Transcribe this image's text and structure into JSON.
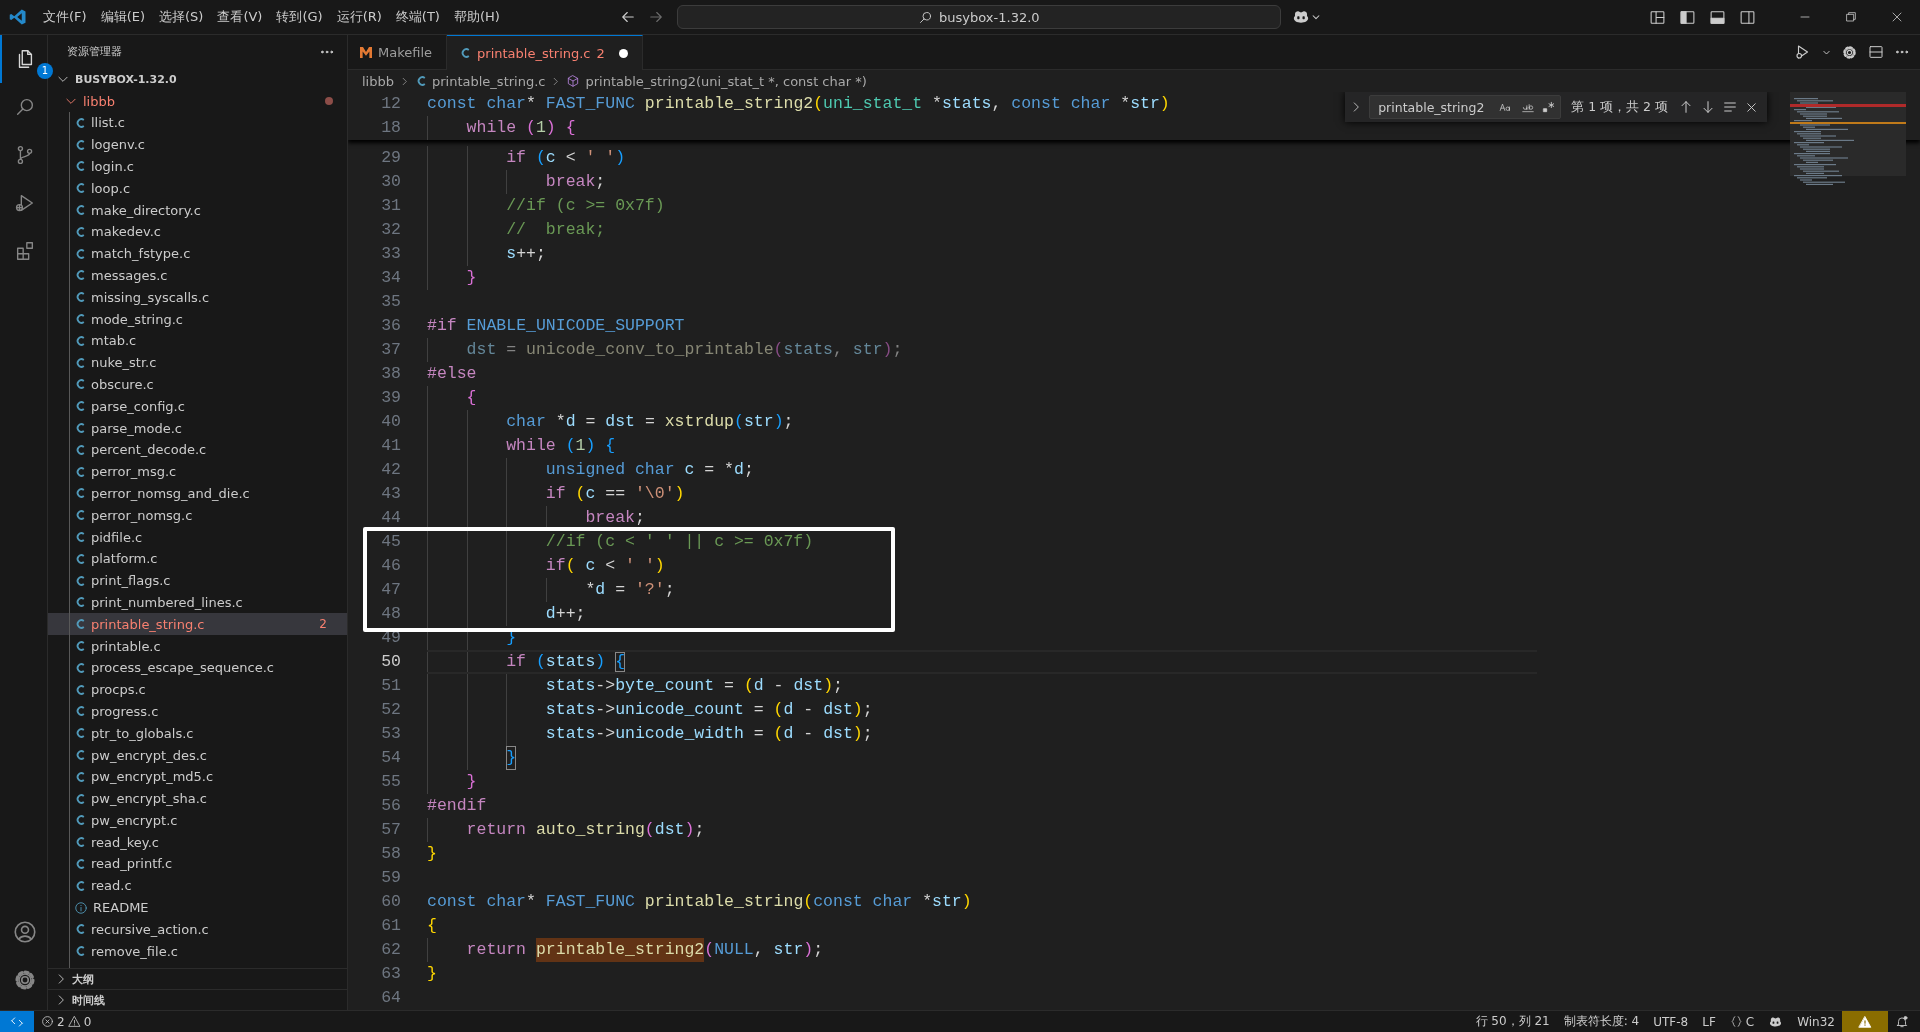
{
  "title_bar": {
    "menus": [
      "文件(F)",
      "编辑(E)",
      "选择(S)",
      "查看(V)",
      "转到(G)",
      "运行(R)",
      "终端(T)",
      "帮助(H)"
    ],
    "command_center": "busybox-1.32.0"
  },
  "activity_bar": {
    "items": [
      {
        "kind": "explorer",
        "selected": true,
        "badge": "1"
      },
      {
        "kind": "search",
        "selected": false
      },
      {
        "kind": "source-control",
        "selected": false
      },
      {
        "kind": "run-debug",
        "selected": false
      },
      {
        "kind": "extensions",
        "selected": false
      }
    ],
    "bottom": [
      {
        "kind": "account"
      },
      {
        "kind": "settings"
      }
    ]
  },
  "sidebar": {
    "title": "资源管理器",
    "root": {
      "label": "BUSYBOX-1.32.0",
      "expanded": true
    },
    "folder": {
      "label": "libbb",
      "expanded": true,
      "has_problems": true
    },
    "files": [
      {
        "label": "llist.c",
        "kind": "c",
        "selected": false,
        "error": false
      },
      {
        "label": "logenv.c",
        "kind": "c",
        "selected": false,
        "error": false
      },
      {
        "label": "login.c",
        "kind": "c",
        "selected": false,
        "error": false
      },
      {
        "label": "loop.c",
        "kind": "c",
        "selected": false,
        "error": false
      },
      {
        "label": "make_directory.c",
        "kind": "c",
        "selected": false,
        "error": false
      },
      {
        "label": "makedev.c",
        "kind": "c",
        "selected": false,
        "error": false
      },
      {
        "label": "match_fstype.c",
        "kind": "c",
        "selected": false,
        "error": false
      },
      {
        "label": "messages.c",
        "kind": "c",
        "selected": false,
        "error": false
      },
      {
        "label": "missing_syscalls.c",
        "kind": "c",
        "selected": false,
        "error": false
      },
      {
        "label": "mode_string.c",
        "kind": "c",
        "selected": false,
        "error": false
      },
      {
        "label": "mtab.c",
        "kind": "c",
        "selected": false,
        "error": false
      },
      {
        "label": "nuke_str.c",
        "kind": "c",
        "selected": false,
        "error": false
      },
      {
        "label": "obscure.c",
        "kind": "c",
        "selected": false,
        "error": false
      },
      {
        "label": "parse_config.c",
        "kind": "c",
        "selected": false,
        "error": false
      },
      {
        "label": "parse_mode.c",
        "kind": "c",
        "selected": false,
        "error": false
      },
      {
        "label": "percent_decode.c",
        "kind": "c",
        "selected": false,
        "error": false
      },
      {
        "label": "perror_msg.c",
        "kind": "c",
        "selected": false,
        "error": false
      },
      {
        "label": "perror_nomsg_and_die.c",
        "kind": "c",
        "selected": false,
        "error": false
      },
      {
        "label": "perror_nomsg.c",
        "kind": "c",
        "selected": false,
        "error": false
      },
      {
        "label": "pidfile.c",
        "kind": "c",
        "selected": false,
        "error": false
      },
      {
        "label": "platform.c",
        "kind": "c",
        "selected": false,
        "error": false
      },
      {
        "label": "print_flags.c",
        "kind": "c",
        "selected": false,
        "error": false
      },
      {
        "label": "print_numbered_lines.c",
        "kind": "c",
        "selected": false,
        "error": false
      },
      {
        "label": "printable_string.c",
        "kind": "c",
        "selected": true,
        "error": true,
        "badge": "2"
      },
      {
        "label": "printable.c",
        "kind": "c",
        "selected": false,
        "error": false
      },
      {
        "label": "process_escape_sequence.c",
        "kind": "c",
        "selected": false,
        "error": false
      },
      {
        "label": "procps.c",
        "kind": "c",
        "selected": false,
        "error": false
      },
      {
        "label": "progress.c",
        "kind": "c",
        "selected": false,
        "error": false
      },
      {
        "label": "ptr_to_globals.c",
        "kind": "c",
        "selected": false,
        "error": false
      },
      {
        "label": "pw_encrypt_des.c",
        "kind": "c",
        "selected": false,
        "error": false
      },
      {
        "label": "pw_encrypt_md5.c",
        "kind": "c",
        "selected": false,
        "error": false
      },
      {
        "label": "pw_encrypt_sha.c",
        "kind": "c",
        "selected": false,
        "error": false
      },
      {
        "label": "pw_encrypt.c",
        "kind": "c",
        "selected": false,
        "error": false
      },
      {
        "label": "read_key.c",
        "kind": "c",
        "selected": false,
        "error": false
      },
      {
        "label": "read_printf.c",
        "kind": "c",
        "selected": false,
        "error": false
      },
      {
        "label": "read.c",
        "kind": "c",
        "selected": false,
        "error": false
      },
      {
        "label": "README",
        "kind": "info",
        "selected": false,
        "error": false
      },
      {
        "label": "recursive_action.c",
        "kind": "c",
        "selected": false,
        "error": false
      },
      {
        "label": "remove_file.c",
        "kind": "c",
        "selected": false,
        "error": false
      }
    ],
    "sections": [
      {
        "label": "大纲",
        "expanded": false
      },
      {
        "label": "时间线",
        "expanded": false
      }
    ]
  },
  "editor": {
    "tabs": [
      {
        "label": "Makefile",
        "kind": "makefile",
        "selected": false,
        "modified": false,
        "error": false
      },
      {
        "label": "printable_string.c",
        "kind": "c",
        "selected": true,
        "modified": true,
        "error": true,
        "badge": "2"
      }
    ],
    "breadcrumb": [
      {
        "label": "libbb",
        "kind": "folder"
      },
      {
        "label": "printable_string.c",
        "kind": "c"
      },
      {
        "label": "printable_string2(uni_stat_t *, const char *)",
        "kind": "function"
      }
    ],
    "find": {
      "value": "printable_string2",
      "result": "第 1 项，共 2 项"
    },
    "sticky_lines": [
      {
        "number": "12",
        "tokens": [
          {
            "kind": "keyword",
            "text": "const"
          },
          {
            "kind": "keyword",
            "text": " char"
          },
          {
            "kind": "plain",
            "text": "* "
          },
          {
            "kind": "macro",
            "text": "FAST_FUNC"
          },
          {
            "kind": "function",
            "text": " printable_string2"
          },
          {
            "kind": "bracket1",
            "text": "("
          },
          {
            "kind": "type",
            "text": "uni_stat_t"
          },
          {
            "kind": "plain",
            "text": " *"
          },
          {
            "kind": "variable",
            "text": "stats"
          },
          {
            "kind": "plain",
            "text": ", "
          },
          {
            "kind": "keyword",
            "text": "const"
          },
          {
            "kind": "keyword",
            "text": " char"
          },
          {
            "kind": "plain",
            "text": " *"
          },
          {
            "kind": "variable",
            "text": "str"
          },
          {
            "kind": "bracket1",
            "text": ")"
          }
        ]
      },
      {
        "number": "18",
        "tokens": [
          {
            "kind": "control",
            "text": "    while"
          },
          {
            "kind": "bracket2",
            "text": " ("
          },
          {
            "kind": "number",
            "text": "1"
          },
          {
            "kind": "bracket2",
            "text": ")"
          },
          {
            "kind": "bracket2",
            "text": " {"
          }
        ]
      }
    ],
    "lines": [
      {
        "number": "29",
        "current": false,
        "tokens": [
          {
            "kind": "control",
            "text": "        if"
          },
          {
            "kind": "bracket3",
            "text": " ("
          },
          {
            "kind": "variable",
            "text": "c"
          },
          {
            "kind": "plain",
            "text": " < "
          },
          {
            "kind": "string",
            "text": "' '"
          },
          {
            "kind": "bracket3",
            "text": ")"
          }
        ]
      },
      {
        "number": "30",
        "current": false,
        "tokens": [
          {
            "kind": "control",
            "text": "            break"
          },
          {
            "kind": "plain",
            "text": ";"
          }
        ]
      },
      {
        "number": "31",
        "current": false,
        "tokens": [
          {
            "kind": "comment",
            "text": "        //if (c >= 0x7f)"
          }
        ]
      },
      {
        "number": "32",
        "current": false,
        "tokens": [
          {
            "kind": "comment",
            "text": "        //  break;"
          }
        ]
      },
      {
        "number": "33",
        "current": false,
        "tokens": [
          {
            "kind": "variable",
            "text": "        s"
          },
          {
            "kind": "plain",
            "text": "++;"
          }
        ]
      },
      {
        "number": "34",
        "current": false,
        "tokens": [
          {
            "kind": "bracket2",
            "text": "    }"
          }
        ]
      },
      {
        "number": "35",
        "current": false
      },
      {
        "number": "36",
        "current": false,
        "tokens": [
          {
            "kind": "preprocessor",
            "text": "#if"
          },
          {
            "kind": "macro",
            "text": " ENABLE_UNICODE_SUPPORT"
          }
        ]
      },
      {
        "number": "37",
        "current": false,
        "tokens": [
          {
            "kind": "variable-dimmed",
            "text": "    dst"
          },
          {
            "kind": "plain-dimmed",
            "text": " = "
          },
          {
            "kind": "function-dimmed",
            "text": "unicode_conv_to_printable"
          },
          {
            "kind": "bracket2-dimmed",
            "text": "("
          },
          {
            "kind": "variable-dimmed",
            "text": "stats"
          },
          {
            "kind": "plain-dimmed",
            "text": ", "
          },
          {
            "kind": "variable-dimmed",
            "text": "str"
          },
          {
            "kind": "bracket2-dimmed",
            "text": ")"
          },
          {
            "kind": "plain-dimmed",
            "text": ";"
          }
        ]
      },
      {
        "number": "38",
        "current": false,
        "tokens": [
          {
            "kind": "preprocessor",
            "text": "#else"
          }
        ]
      },
      {
        "number": "39",
        "current": false,
        "tokens": [
          {
            "kind": "bracket2",
            "text": "    {"
          }
        ]
      },
      {
        "number": "40",
        "current": false,
        "tokens": [
          {
            "kind": "keyword",
            "text": "        char"
          },
          {
            "kind": "plain",
            "text": " *"
          },
          {
            "kind": "variable",
            "text": "d"
          },
          {
            "kind": "plain",
            "text": " = "
          },
          {
            "kind": "variable",
            "text": "dst"
          },
          {
            "kind": "plain",
            "text": " = "
          },
          {
            "kind": "function",
            "text": "xstrdup"
          },
          {
            "kind": "bracket3",
            "text": "("
          },
          {
            "kind": "variable",
            "text": "str"
          },
          {
            "kind": "bracket3",
            "text": ")"
          },
          {
            "kind": "plain",
            "text": ";"
          }
        ]
      },
      {
        "number": "41",
        "current": false,
        "tokens": [
          {
            "kind": "control",
            "text": "        while"
          },
          {
            "kind": "bracket3",
            "text": " ("
          },
          {
            "kind": "number",
            "text": "1"
          },
          {
            "kind": "bracket3",
            "text": ")"
          },
          {
            "kind": "bracket3",
            "text": " {"
          }
        ]
      },
      {
        "number": "42",
        "current": false,
        "tokens": [
          {
            "kind": "keyword",
            "text": "            unsigned"
          },
          {
            "kind": "keyword",
            "text": " char"
          },
          {
            "kind": "variable",
            "text": " c"
          },
          {
            "kind": "plain",
            "text": " = *"
          },
          {
            "kind": "variable",
            "text": "d"
          },
          {
            "kind": "plain",
            "text": ";"
          }
        ]
      },
      {
        "number": "43",
        "current": false,
        "tokens": [
          {
            "kind": "control",
            "text": "            if"
          },
          {
            "kind": "bracket1",
            "text": " ("
          },
          {
            "kind": "variable",
            "text": "c"
          },
          {
            "kind": "plain",
            "text": " == "
          },
          {
            "kind": "string",
            "text": "'\\0'"
          },
          {
            "kind": "bracket1",
            "text": ")"
          }
        ]
      },
      {
        "number": "44",
        "current": false,
        "tokens": [
          {
            "kind": "control",
            "text": "                break"
          },
          {
            "kind": "plain",
            "text": ";"
          }
        ]
      }
    ],
    "highlight_box": {
      "lines": [
        {
          "number": "45",
          "current": false,
          "tokens": [
            {
              "kind": "comment",
              "text": "            //if (c < ' ' || c >= 0x7f)"
            }
          ]
        },
        {
          "number": "46",
          "current": false,
          "tokens": [
            {
              "kind": "control",
              "text": "            if"
            },
            {
              "kind": "bracket1",
              "text": "("
            },
            {
              "kind": "variable",
              "text": " c"
            },
            {
              "kind": "plain",
              "text": " < "
            },
            {
              "kind": "string",
              "text": "' '"
            },
            {
              "kind": "bracket1",
              "text": ")"
            }
          ]
        },
        {
          "number": "47",
          "current": false,
          "tokens": [
            {
              "kind": "plain",
              "text": "                *"
            },
            {
              "kind": "variable",
              "text": "d"
            },
            {
              "kind": "plain",
              "text": " = "
            },
            {
              "kind": "string",
              "text": "'?'"
            },
            {
              "kind": "plain",
              "text": ";"
            }
          ]
        },
        {
          "number": "48",
          "current": false,
          "tokens": [
            {
              "kind": "variable",
              "text": "            d"
            },
            {
              "kind": "plain",
              "text": "++;"
            }
          ]
        }
      ]
    },
    "lines_after": [
      {
        "number": "49",
        "current": false,
        "tokens": [
          {
            "kind": "bracket3",
            "text": "        }"
          }
        ]
      },
      {
        "number": "50",
        "current": true,
        "tokens": [
          {
            "kind": "control",
            "text": "        if"
          },
          {
            "kind": "bracket3",
            "text": " ("
          },
          {
            "kind": "variable",
            "text": "stats"
          },
          {
            "kind": "bracket3",
            "text": ") "
          },
          {
            "kind": "bracket-match",
            "text": "{"
          }
        ]
      },
      {
        "number": "51",
        "current": false,
        "tokens": [
          {
            "kind": "variable",
            "text": "            stats"
          },
          {
            "kind": "plain",
            "text": "->"
          },
          {
            "kind": "variable",
            "text": "byte_count"
          },
          {
            "kind": "plain",
            "text": " = "
          },
          {
            "kind": "bracket1",
            "text": "("
          },
          {
            "kind": "variable",
            "text": "d"
          },
          {
            "kind": "plain",
            "text": " - "
          },
          {
            "kind": "variable",
            "text": "dst"
          },
          {
            "kind": "bracket1",
            "text": ")"
          },
          {
            "kind": "plain",
            "text": ";"
          }
        ]
      },
      {
        "number": "52",
        "current": false,
        "tokens": [
          {
            "kind": "variable",
            "text": "            stats"
          },
          {
            "kind": "plain",
            "text": "->"
          },
          {
            "kind": "variable",
            "text": "unicode_count"
          },
          {
            "kind": "plain",
            "text": " = "
          },
          {
            "kind": "bracket1",
            "text": "("
          },
          {
            "kind": "variable",
            "text": "d"
          },
          {
            "kind": "plain",
            "text": " - "
          },
          {
            "kind": "variable",
            "text": "dst"
          },
          {
            "kind": "bracket1",
            "text": ")"
          },
          {
            "kind": "plain",
            "text": ";"
          }
        ]
      },
      {
        "number": "53",
        "current": false,
        "tokens": [
          {
            "kind": "variable",
            "text": "            stats"
          },
          {
            "kind": "plain",
            "text": "->"
          },
          {
            "kind": "variable",
            "text": "unicode_width"
          },
          {
            "kind": "plain",
            "text": " = "
          },
          {
            "kind": "bracket1",
            "text": "("
          },
          {
            "kind": "variable",
            "text": "d"
          },
          {
            "kind": "plain",
            "text": " - "
          },
          {
            "kind": "variable",
            "text": "dst"
          },
          {
            "kind": "bracket1",
            "text": ")"
          },
          {
            "kind": "plain",
            "text": ";"
          }
        ]
      },
      {
        "number": "54",
        "current": false,
        "tokens": [
          {
            "kind": "bracket-match",
            "text": "        }"
          }
        ]
      },
      {
        "number": "55",
        "current": false,
        "tokens": [
          {
            "kind": "bracket2",
            "text": "    }"
          }
        ]
      },
      {
        "number": "56",
        "current": false,
        "tokens": [
          {
            "kind": "preprocessor",
            "text": "#endif"
          }
        ]
      },
      {
        "number": "57",
        "current": false,
        "tokens": [
          {
            "kind": "control",
            "text": "    return"
          },
          {
            "kind": "function",
            "text": " auto_string"
          },
          {
            "kind": "bracket2",
            "text": "("
          },
          {
            "kind": "variable",
            "text": "dst"
          },
          {
            "kind": "bracket2",
            "text": ")"
          },
          {
            "kind": "plain",
            "text": ";"
          }
        ]
      },
      {
        "number": "58",
        "current": false,
        "tokens": [
          {
            "kind": "bracket1",
            "text": "}"
          }
        ]
      },
      {
        "number": "59",
        "current": false
      },
      {
        "number": "60",
        "current": false,
        "tokens": [
          {
            "kind": "keyword",
            "text": "const"
          },
          {
            "kind": "keyword",
            "text": " char"
          },
          {
            "kind": "plain",
            "text": "* "
          },
          {
            "kind": "macro",
            "text": "FAST_FUNC"
          },
          {
            "kind": "function",
            "text": " printable_string"
          },
          {
            "kind": "bracket1",
            "text": "("
          },
          {
            "kind": "keyword",
            "text": "const"
          },
          {
            "kind": "keyword",
            "text": " char"
          },
          {
            "kind": "plain",
            "text": " *"
          },
          {
            "kind": "variable",
            "text": "str"
          },
          {
            "kind": "bracket1",
            "text": ")"
          }
        ]
      },
      {
        "number": "61",
        "current": false,
        "tokens": [
          {
            "kind": "bracket1",
            "text": "{"
          }
        ]
      },
      {
        "number": "62",
        "current": false,
        "tokens": [
          {
            "kind": "control",
            "text": "    return "
          },
          {
            "kind": "search-match",
            "text": "printable_string2"
          },
          {
            "kind": "bracket2",
            "text": "("
          },
          {
            "kind": "macro",
            "text": "NULL"
          },
          {
            "kind": "plain",
            "text": ", "
          },
          {
            "kind": "variable",
            "text": "str"
          },
          {
            "kind": "bracket2",
            "text": ")"
          },
          {
            "kind": "plain",
            "text": ";"
          }
        ]
      },
      {
        "number": "63",
        "current": false,
        "tokens": [
          {
            "kind": "bracket1",
            "text": "}"
          }
        ]
      },
      {
        "number": "64",
        "current": false
      }
    ]
  },
  "status_bar": {
    "errors": "2",
    "warnings": "0",
    "items": [
      "行 50，列 21",
      "制表符长度: 4",
      "UTF-8",
      "LF"
    ],
    "language": "C",
    "platform": "Win32"
  }
}
